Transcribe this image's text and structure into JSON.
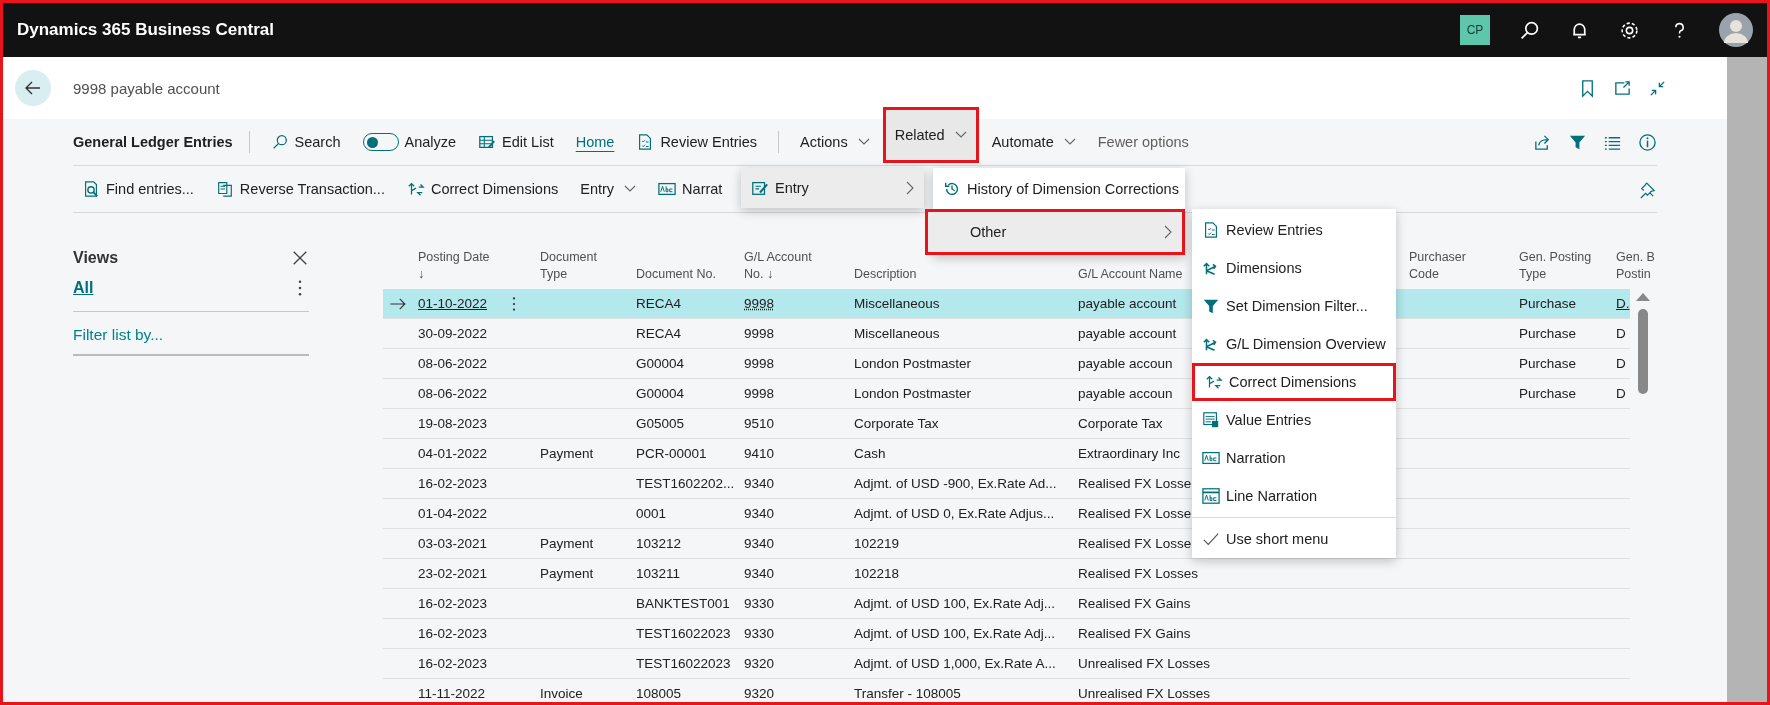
{
  "app": {
    "title": "Dynamics 365 Business Central",
    "user_initials": "CP"
  },
  "page": {
    "title": "9998 payable account"
  },
  "toolbar": {
    "caption": "General Ledger Entries",
    "search": "Search",
    "analyze": {
      "label": "Analyze",
      "on": false
    },
    "edit_list": "Edit List",
    "tabs": [
      {
        "label": "Home",
        "selected": true
      }
    ],
    "review": "Review Entries",
    "menus": [
      {
        "label": "Actions",
        "expanded": false,
        "highlighted": false
      },
      {
        "label": "Related",
        "expanded": true,
        "highlighted": true
      },
      {
        "label": "Automate",
        "expanded": false,
        "highlighted": false
      }
    ],
    "fewer": "Fewer options"
  },
  "actions": [
    {
      "kind": "find",
      "label": "Find entries..."
    },
    {
      "kind": "reverse",
      "label": "Reverse Transaction..."
    },
    {
      "kind": "correct",
      "label": "Correct Dimensions"
    },
    {
      "kind": "dropdown",
      "label": "Entry"
    },
    {
      "kind": "narration",
      "label": "Narrat"
    }
  ],
  "views": {
    "title": "Views",
    "items": [
      {
        "label": "All",
        "selected": true
      }
    ],
    "filter": "Filter list by..."
  },
  "table": {
    "columns": [
      {
        "lines": [
          "Posting Date",
          "↓"
        ]
      },
      {
        "lines": [
          "Document",
          "Type"
        ]
      },
      {
        "lines": [
          "Document No."
        ]
      },
      {
        "lines": [
          "G/L Account",
          "No. ↓"
        ]
      },
      {
        "lines": [
          "Description"
        ]
      },
      {
        "lines": [
          "G/L Account Name"
        ]
      },
      {
        "lines": [
          "Purchaser",
          "Code"
        ]
      },
      {
        "lines": [
          "Gen. Posting",
          "Type"
        ]
      },
      {
        "lines": [
          "Gen. B",
          "Postin"
        ]
      }
    ],
    "rows": [
      {
        "selected": true,
        "date": "01-10-2022",
        "doc_no": "RECA4",
        "account_no": "9998",
        "description": "Miscellaneous",
        "account_name": "payable account",
        "posting_type": "Purchase",
        "bus_posting": "D."
      },
      {
        "selected": false,
        "date": "30-09-2022",
        "doc_no": "RECA4",
        "account_no": "9998",
        "description": "Miscellaneous",
        "account_name": "payable account",
        "posting_type": "Purchase",
        "bus_posting": "D"
      },
      {
        "selected": false,
        "date": "08-06-2022",
        "doc_no": "G00004",
        "account_no": "9998",
        "description": "London Postmaster",
        "account_name": "payable accoun",
        "posting_type": "Purchase",
        "bus_posting": "D"
      },
      {
        "selected": false,
        "date": "08-06-2022",
        "doc_no": "G00004",
        "account_no": "9998",
        "description": "London Postmaster",
        "account_name": "payable accoun",
        "posting_type": "Purchase",
        "bus_posting": "D"
      },
      {
        "selected": false,
        "date": "19-08-2023",
        "doc_no": "G05005",
        "account_no": "9510",
        "description": "Corporate Tax",
        "account_name": "Corporate Tax"
      },
      {
        "selected": false,
        "date": "04-01-2022",
        "doc_type": "Payment",
        "doc_no": "PCR-00001",
        "account_no": "9410",
        "description": "Cash",
        "account_name": "Extraordinary Inc"
      },
      {
        "selected": false,
        "date": "16-02-2023",
        "doc_no": "TEST1602202...",
        "account_no": "9340",
        "description": "Adjmt. of USD -900, Ex.Rate Ad...",
        "account_name": "Realised FX Losse"
      },
      {
        "selected": false,
        "date": "01-04-2022",
        "doc_no": "0001",
        "account_no": "9340",
        "description": "Adjmt. of USD 0, Ex.Rate Adjus...",
        "account_name": "Realised FX Losse"
      },
      {
        "selected": false,
        "date": "03-03-2021",
        "doc_type": "Payment",
        "doc_no": "103212",
        "account_no": "9340",
        "description": "102219",
        "account_name": "Realised FX Losse"
      },
      {
        "selected": false,
        "date": "23-02-2021",
        "doc_type": "Payment",
        "doc_no": "103211",
        "account_no": "9340",
        "description": "102218",
        "account_name": "Realised FX Losses"
      },
      {
        "selected": false,
        "date": "16-02-2023",
        "doc_no": "BANKTEST001",
        "account_no": "9330",
        "description": "Adjmt. of USD 100, Ex.Rate Adj...",
        "account_name": "Realised FX Gains"
      },
      {
        "selected": false,
        "date": "16-02-2023",
        "doc_no": "TEST16022023",
        "account_no": "9330",
        "description": "Adjmt. of USD 100, Ex.Rate Adj...",
        "account_name": "Realised FX Gains"
      },
      {
        "selected": false,
        "date": "16-02-2023",
        "doc_no": "TEST16022023",
        "account_no": "9320",
        "description": "Adjmt. of USD 1,000, Ex.Rate A...",
        "account_name": "Unrealised FX Losses"
      },
      {
        "selected": false,
        "date": "11-11-2022",
        "doc_type": "Invoice",
        "doc_no": "108005",
        "account_no": "9320",
        "description": "Transfer - 108005",
        "account_name": "Unrealised FX Losses"
      }
    ]
  },
  "related_menu": {
    "items": [
      {
        "label": "Entry",
        "selected": true
      }
    ]
  },
  "entry_menu": {
    "items": [
      {
        "kind": "history",
        "label": "History of Dimension Corrections",
        "selected": false,
        "highlighted": false
      },
      {
        "kind": "submenu",
        "label": "Other",
        "selected": true,
        "highlighted": true
      }
    ]
  },
  "other_menu": {
    "items": [
      {
        "kind": "review",
        "label": "Review Entries",
        "highlighted": false
      },
      {
        "kind": "dimensions",
        "label": "Dimensions",
        "highlighted": false
      },
      {
        "kind": "filter",
        "label": "Set Dimension Filter...",
        "highlighted": false
      },
      {
        "kind": "dimensions",
        "label": "G/L Dimension Overview",
        "highlighted": false
      },
      {
        "kind": "correct",
        "label": "Correct Dimensions",
        "highlighted": true
      },
      {
        "kind": "value",
        "label": "Value Entries",
        "highlighted": false
      },
      {
        "kind": "narration",
        "label": "Narration",
        "highlighted": false
      },
      {
        "kind": "line-narration",
        "label": "Line Narration",
        "highlighted": false
      },
      {
        "kind": "check",
        "label": "Use short menu",
        "checked": true,
        "highlighted": false
      }
    ]
  }
}
